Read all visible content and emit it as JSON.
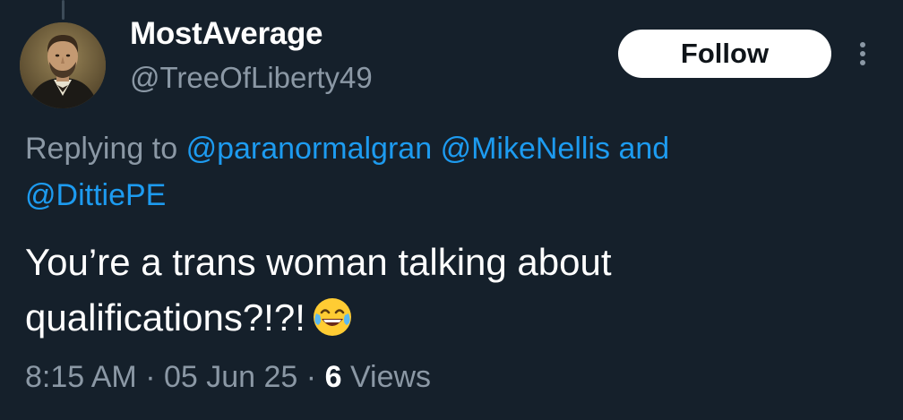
{
  "user": {
    "display_name": "MostAverage",
    "handle": "@TreeOfLiberty49"
  },
  "actions": {
    "follow_label": "Follow",
    "more_icon": "more-vertical-icon"
  },
  "reply": {
    "prefix": "Replying to",
    "mentions": [
      "@paranormalgran",
      "@MikeNellis",
      "@DittiePE"
    ],
    "conjunction": "and"
  },
  "tweet": {
    "text_line1": "You’re a trans woman talking about",
    "text_line2": "qualifications?!?!",
    "emoji": "face-with-tears-of-joy"
  },
  "meta": {
    "time": "8:15 AM",
    "separator": "·",
    "date": "05 Jun 25",
    "views_count": "6",
    "views_label": "Views"
  },
  "colors": {
    "background": "#15202b",
    "accent": "#1d9bf0",
    "secondary_text": "#8b98a5",
    "primary_text": "#ffffff"
  }
}
